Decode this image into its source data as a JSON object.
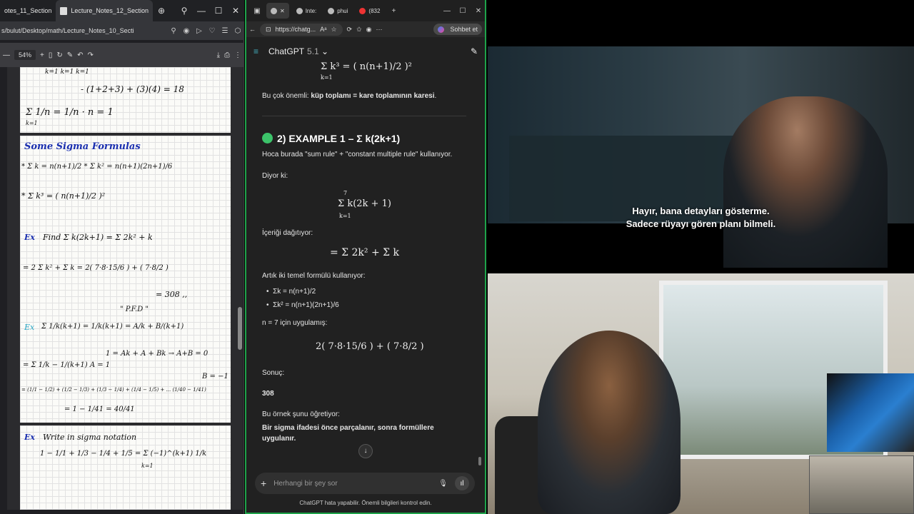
{
  "pdf_window": {
    "tabs": [
      "otes_11_Section",
      "Lecture_Notes_12_Section"
    ],
    "address": "s/bulut/Desktop/math/Lecture_Notes_10_Secti",
    "zoom": "54%",
    "notes": {
      "l1": "k=1      k=1      k=1",
      "l2": "- (1+2+3) + (3)(4) = 18",
      "l3": "Σ 1/n = 1/n · n = 1",
      "l3b": "k=1",
      "sigma_title": "Some Sigma Formulas",
      "f1": "* Σ k = n(n+1)/2     * Σ k² = n(n+1)(2n+1)/6",
      "f2": "* Σ k³ = ( n(n+1)/2 )²",
      "ex1": "Find Σ k(2k+1) = Σ 2k² + k",
      "ex1b": "= 2 Σ k² + Σ k = 2( 7·8·15/6 ) + ( 7·8/2 )",
      "ex1c": "= 308 ,,",
      "pfd": "\" P.F.D \"",
      "ex2": "Σ 1/k(k+1) =    1/k(k+1) = A/k + B/(k+1)",
      "ex2b": "1 = Ak + A + Bk → A+B = 0",
      "ex2c": "= Σ 1/k − 1/(k+1)          A = 1",
      "ex2d": "B = −1",
      "ex2e": "= (1/1 − 1/2) + (1/2 − 1/3) + (1/3 − 1/4) + (1/4 − 1/5) + ... (1/40 − 1/41)",
      "ex2f": "= 1 − 1/41 = 40/41",
      "ex3": "Write in sigma notation",
      "ex3b": "1 − 1/1 + 1/3 − 1/4 + 1/5 = Σ (−1)^(k+1) 1/k",
      "ex3c": "k=1"
    }
  },
  "gpt_window": {
    "tabs": [
      "Inte:",
      "phui",
      "(832"
    ],
    "url": "https://chatg...",
    "sohbet": "Sohbet et",
    "model": "ChatGPT",
    "version": "5.1",
    "top_math": "Σ k³ = ( n(n+1)/2 )²",
    "top_math_sub": "k=1",
    "p1_pre": "Bu çok önemli: ",
    "p1_bold": "küp toplamı = kare toplamının karesi",
    "p1_post": ".",
    "heading": "2) EXAMPLE 1 – Σ k(2k+1)",
    "p2": "Hoca burada \"sum rule\" + \"constant multiple rule\" kullanıyor.",
    "p3": "Diyor ki:",
    "m1": "Σ k(2k + 1)",
    "m1_top": "7",
    "m1_bot": "k=1",
    "p4": "İçeriği dağıtıyor:",
    "m2": "= Σ 2k² + Σ k",
    "p5": "Artık iki temel formülü kullanıyor:",
    "b1": "Σk = n(n+1)/2",
    "b2": "Σk² = n(n+1)(2n+1)/6",
    "p6": "n = 7 için uygulamış:",
    "m3": "2( 7·8·15/6 ) + ( 7·8/2 )",
    "p7": "Sonuç:",
    "result": "308",
    "p8": "Bu örnek şunu öğretiyor:",
    "p9": "Bir sigma ifadesi önce parçalanır, sonra formüllere uygulanır.",
    "input_placeholder": "Herhangi bir şey sor",
    "footer": "ChatGPT hata yapabilir. Önemli bilgileri kontrol edin."
  },
  "video": {
    "subtitle_1": "Hayır, bana detayları gösterme.",
    "subtitle_2": "Sadece rüyayı gören planı bilmeli."
  }
}
